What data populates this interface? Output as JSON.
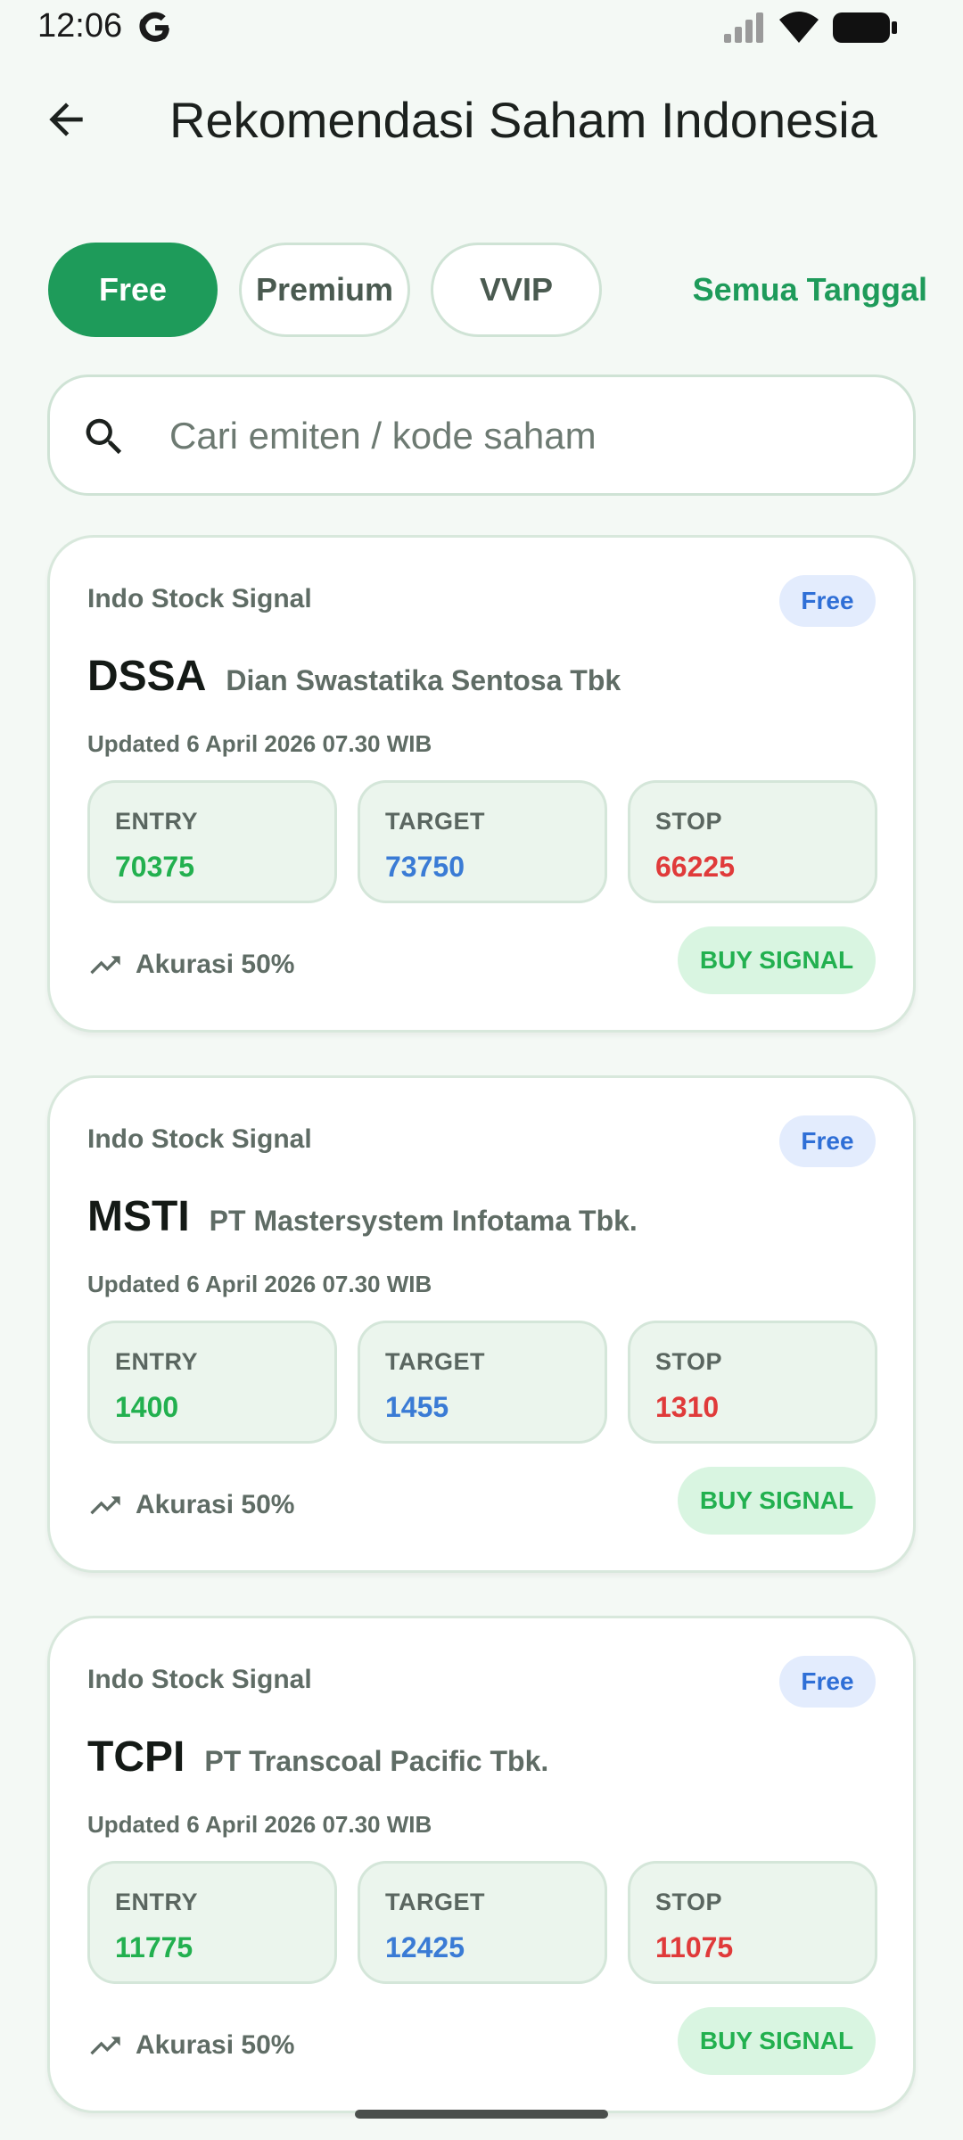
{
  "status_bar": {
    "time": "12:06",
    "icons": [
      "google-icon",
      "signal-icon",
      "wifi-icon",
      "battery-icon"
    ]
  },
  "header": {
    "title": "Rekomendasi Saham Indonesia"
  },
  "tabs": [
    {
      "label": "Free",
      "active": true
    },
    {
      "label": "Premium",
      "active": false
    },
    {
      "label": "VVIP",
      "active": false
    }
  ],
  "date_filter": "Semua Tanggal",
  "search": {
    "value": "",
    "placeholder": "Cari emiten / kode saham"
  },
  "colors": {
    "accent": "#1e9b5a",
    "entry": "#22b04f",
    "target": "#3a7bd5",
    "stop": "#e03a3a",
    "tier_badge_bg": "#e3ecfd",
    "buy_badge_bg": "#d9f5e1"
  },
  "cards": [
    {
      "provider": "Indo Stock Signal",
      "tier": "Free",
      "ticker": "DSSA",
      "company": "Dian Swastatika Sentosa Tbk",
      "updated": "Updated 6 April 2026 07.30 WIB",
      "entry_label": "ENTRY",
      "entry": "70375",
      "target_label": "TARGET",
      "target": "73750",
      "stop_label": "STOP",
      "stop": "66225",
      "accuracy": "Akurasi 50%",
      "signal": "BUY SIGNAL"
    },
    {
      "provider": "Indo Stock Signal",
      "tier": "Free",
      "ticker": "MSTI",
      "company": "PT Mastersystem Infotama Tbk.",
      "updated": "Updated 6 April 2026 07.30 WIB",
      "entry_label": "ENTRY",
      "entry": "1400",
      "target_label": "TARGET",
      "target": "1455",
      "stop_label": "STOP",
      "stop": "1310",
      "accuracy": "Akurasi 50%",
      "signal": "BUY SIGNAL"
    },
    {
      "provider": "Indo Stock Signal",
      "tier": "Free",
      "ticker": "TCPI",
      "company": "PT Transcoal Pacific Tbk.",
      "updated": "Updated 6 April 2026 07.30 WIB",
      "entry_label": "ENTRY",
      "entry": "11775",
      "target_label": "TARGET",
      "target": "12425",
      "stop_label": "STOP",
      "stop": "11075",
      "accuracy": "Akurasi 50%",
      "signal": "BUY SIGNAL"
    }
  ]
}
